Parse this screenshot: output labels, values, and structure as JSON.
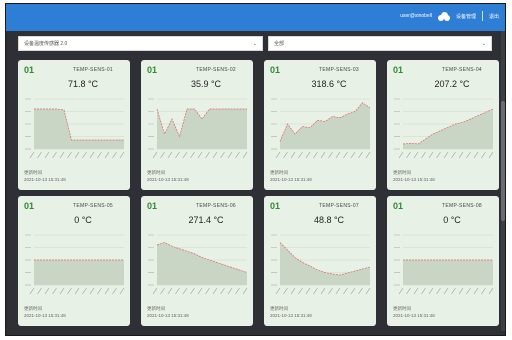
{
  "header": {
    "user_label": "user@sinobell",
    "settings_label": "设备管理",
    "logout_label": "退出"
  },
  "filters": {
    "left": "设备温度传感器 2.0",
    "right": "全部"
  },
  "cards": [
    {
      "num": "01",
      "sensor": "TEMP-SENS-01",
      "value": "71.8 °C",
      "foot1": "更新时间",
      "foot2": "2021-10-13 15:31:48",
      "chart_data": {
        "type": "area",
        "ylim": [
          0,
          100
        ],
        "values": [
          80,
          80,
          80,
          80,
          78,
          18,
          18,
          18,
          18,
          18,
          18,
          18,
          18
        ]
      }
    },
    {
      "num": "01",
      "sensor": "TEMP-SENS-02",
      "value": "35.9 °C",
      "foot1": "更新时间",
      "foot2": "2021-10-13 15:31:48",
      "chart_data": {
        "type": "area",
        "ylim": [
          0,
          100
        ],
        "values": [
          80,
          30,
          60,
          25,
          80,
          80,
          60,
          80,
          80,
          80,
          80,
          80,
          80
        ]
      }
    },
    {
      "num": "01",
      "sensor": "TEMP-SENS-03",
      "value": "318.6 °C",
      "foot1": "更新时间",
      "foot2": "2021-10-13 15:31:48",
      "chart_data": {
        "type": "area",
        "ylim": [
          0,
          400
        ],
        "values": [
          60,
          200,
          120,
          180,
          170,
          230,
          220,
          260,
          250,
          280,
          300,
          370,
          330
        ]
      }
    },
    {
      "num": "01",
      "sensor": "TEMP-SENS-04",
      "value": "207.2 °C",
      "foot1": "更新时间",
      "foot2": "2021-10-13 15:31:48",
      "chart_data": {
        "type": "area",
        "ylim": [
          0,
          300
        ],
        "values": [
          30,
          35,
          30,
          60,
          90,
          110,
          130,
          150,
          160,
          180,
          200,
          220,
          240
        ]
      }
    },
    {
      "num": "01",
      "sensor": "TEMP-SENS-05",
      "value": "0 °C",
      "foot1": "更新时间",
      "foot2": "2021-10-13 15:31:48",
      "chart_data": {
        "type": "area",
        "ylim": [
          -1,
          1
        ],
        "values": [
          0,
          0,
          0,
          0,
          0,
          0,
          0,
          0,
          0,
          0,
          0,
          0,
          0
        ]
      }
    },
    {
      "num": "01",
      "sensor": "TEMP-SENS-06",
      "value": "271.4 °C",
      "foot1": "更新时间",
      "foot2": "2021-10-13 15:31:48",
      "chart_data": {
        "type": "area",
        "ylim": [
          0,
          400
        ],
        "values": [
          320,
          340,
          310,
          290,
          270,
          250,
          220,
          200,
          180,
          160,
          140,
          120,
          100
        ]
      }
    },
    {
      "num": "01",
      "sensor": "TEMP-SENS-07",
      "value": "48.8 °C",
      "foot1": "更新时间",
      "foot2": "2021-10-13 15:31:48",
      "chart_data": {
        "type": "area",
        "ylim": [
          0,
          100
        ],
        "values": [
          85,
          70,
          55,
          45,
          38,
          30,
          25,
          22,
          20,
          24,
          28,
          32,
          36
        ]
      }
    },
    {
      "num": "01",
      "sensor": "TEMP-SENS-08",
      "value": "0 °C",
      "foot1": "更新时间",
      "foot2": "2021-10-13 15:31:48",
      "chart_data": {
        "type": "area",
        "ylim": [
          -1,
          1
        ],
        "values": [
          0,
          0,
          0,
          0,
          0,
          0,
          0,
          0,
          0,
          0,
          0,
          0,
          0
        ]
      }
    }
  ],
  "colors": {
    "accent": "#2e7ed6",
    "card_bg": "#e8f1e6",
    "number": "#2f8a34",
    "line": "#e06666",
    "area": "#c9d6c5"
  }
}
